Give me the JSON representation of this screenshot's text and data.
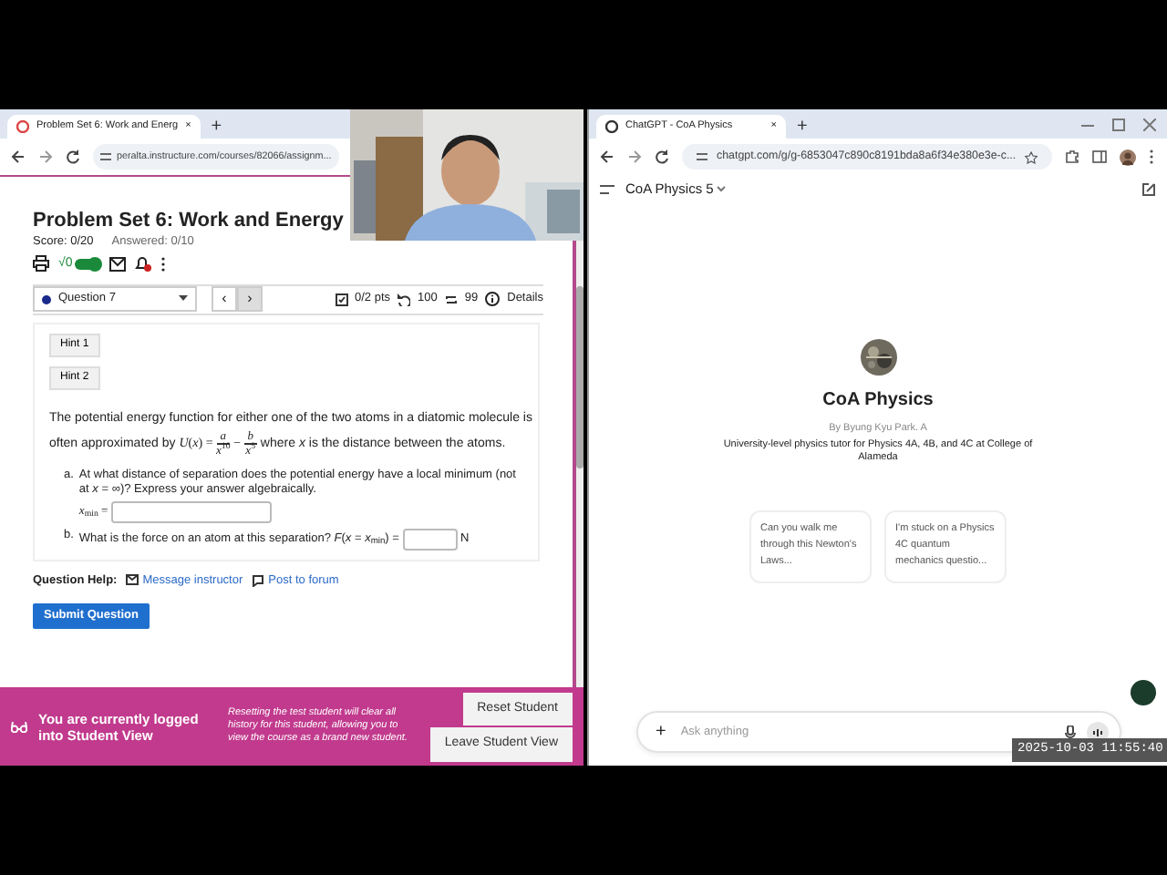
{
  "left_window": {
    "tab": {
      "title": "Problem Set 6: Work and Energ",
      "close": "×"
    },
    "new_tab": "+",
    "url": "peralta.instructure.com/courses/82066/assignm...",
    "assignment": {
      "title": "Problem Set 6: Work and Energy",
      "score": "Score: 0/20",
      "answered": "Answered: 0/10",
      "toggle": {
        "label": "√0",
        "on": true
      },
      "question_select": "Question 7",
      "prev": "‹",
      "next": "›",
      "points": "0/2 pts",
      "attempts": "100",
      "regens": "99",
      "details": "Details"
    },
    "hints": [
      "Hint 1",
      "Hint 2"
    ],
    "problem": {
      "before": "The potential energy function for either one of the two atoms in a diatomic molecule is often approximated by",
      "lhs": "*U*(*x*) =",
      "terms": [
        {
          "num": "*a*",
          "den": "*x*$^{10}$"
        },
        {
          "sign": "−",
          "num": "*b*",
          "den": "*x*$^{5}$"
        }
      ],
      "after": "where *x* is the distance between the atoms."
    },
    "parts": [
      {
        "label": "a.",
        "text": "At what distance of separation does the potential energy have a local minimum (not at *x* = ∞)? Express your answer algebraically.",
        "answer_label": "*x*$_{min}$ ="
      },
      {
        "label": "b.",
        "text": "What is the force on an atom at this separation? *F*(*x* = *x*$_{min}$) =",
        "unit": "N"
      }
    ],
    "help": {
      "label": "Question Help:",
      "links": [
        "Message instructor",
        "Post to forum"
      ]
    },
    "submit": "Submit Question",
    "student_view": {
      "message": "You are currently logged into Student View",
      "note": "Resetting the test student will clear all history for this student, allowing you to view the course as a brand new student.",
      "buttons": [
        "Reset Student",
        "Leave Student View"
      ]
    }
  },
  "right_window": {
    "tab": {
      "title": "ChatGPT - CoA Physics",
      "close": "×"
    },
    "new_tab": "+",
    "url": "chatgpt.com/g/g-6853047c890c8191bda8a6f34e380e3e-c...",
    "model": "CoA Physics 5",
    "gpt_name": "CoA Physics",
    "author": "By Byung Kyu Park. A",
    "description": "University-level physics tutor for Physics 4A, 4B, and 4C at College of Alameda",
    "suggestions": [
      "Can you walk me through this Newton's Laws...",
      "I'm stuck on a Physics 4C quantum mechanics questio..."
    ],
    "composer": {
      "plus": "+",
      "placeholder": "Ask anything"
    }
  },
  "timestamp": "2025-10-03 11:55:40"
}
